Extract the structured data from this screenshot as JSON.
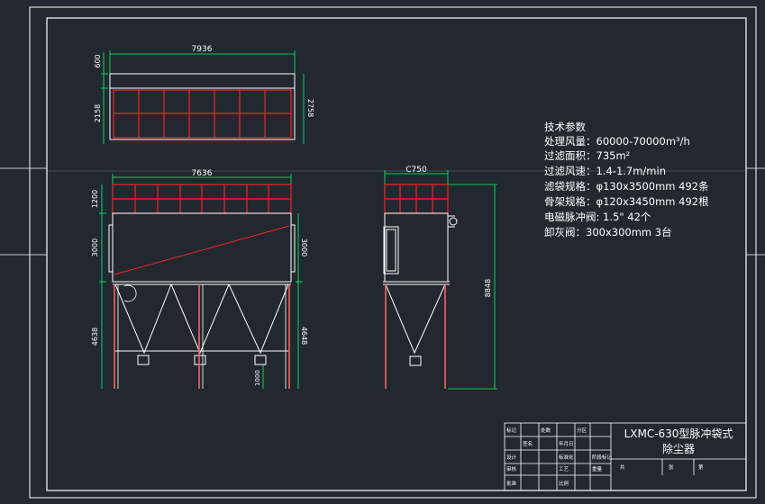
{
  "colors": {
    "background": "#212830",
    "frame": "#ffffff",
    "dimension": "#00ff66",
    "outline": "#ffffff",
    "bag": "#ff2020",
    "text": "#ffffff"
  },
  "top_view": {
    "width_dim": "7936",
    "height_dims": [
      "600",
      "2158"
    ],
    "right_dim": "2758"
  },
  "front_view": {
    "width_dim": "7636",
    "left_dims": [
      "1200",
      "3000",
      "4638"
    ],
    "right_dims": [
      "3000",
      "4648",
      "1000"
    ]
  },
  "side_view": {
    "width_dim": "C750",
    "height_dim": "8848"
  },
  "specs": {
    "title": "技术参数",
    "lines": [
      "处理风量：60000-70000m³/h",
      "过滤面积：735m²",
      "过滤风速：1.4-1.7m/min",
      "滤袋规格：φ130x3500mm 492条",
      "骨架规格：φ120x3450mm 492根",
      "电磁脉冲阀:    1.5\"     42个",
      "卸灰阀：300x300mm   3台"
    ]
  },
  "title_block": {
    "product_line1": "LXMC-630型脉冲袋式",
    "product_line2": "除尘器",
    "cells": [
      "标记",
      "处数",
      "分区",
      "签名",
      "年月日",
      "设计",
      "标准化",
      "审核",
      "工艺",
      "批准",
      "阶段标记",
      "重量",
      "比例",
      "共",
      "张",
      "第"
    ]
  }
}
